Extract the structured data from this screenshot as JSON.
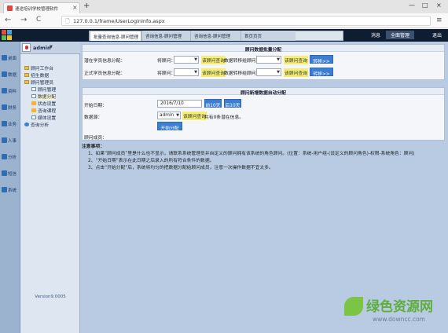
{
  "browser": {
    "tab_title": "速途培训学校管理软件",
    "tab_close": "×",
    "new_tab": "+",
    "window_controls": [
      "—",
      "□",
      "×"
    ],
    "nav": {
      "back": "←",
      "forward": "→",
      "reload": "C"
    },
    "url": "127.0.0.1/frame/UserLoginInfo.aspx",
    "menu": "≡"
  },
  "header": {
    "logo_colors": [
      "#e64b3b",
      "#4aa3df",
      "#5dbb46",
      "#f2c230"
    ],
    "tabs": [
      {
        "label": "批量查询信息-顾问管理",
        "active": true,
        "close": "×"
      },
      {
        "label": "咨询信息-顾问管理",
        "active": false
      },
      {
        "label": "咨询信息-顾问管理",
        "active": false
      },
      {
        "label": "首页页页",
        "active": false
      }
    ],
    "right": {
      "messages": "消息",
      "admin": "全面管理",
      "logout": "退出"
    }
  },
  "quickbar": [
    "桌面",
    "数据",
    "资料",
    "财务",
    "业务",
    "人事",
    "分析",
    "短信",
    "系统"
  ],
  "tree": {
    "username": "admin",
    "dropdown": "▼",
    "nodes": [
      {
        "label": "顾问工作台",
        "icon": "folder"
      },
      {
        "label": "招生数据",
        "icon": "folder"
      },
      {
        "label": "顾问管理员",
        "icon": "folder"
      },
      {
        "label": "顾问管理",
        "icon": "leaf"
      },
      {
        "label": "数据分配",
        "icon": "leaf"
      },
      {
        "label": "状态设置",
        "icon": "cart"
      },
      {
        "label": "咨询课程",
        "icon": "cart"
      },
      {
        "label": "媒体设置",
        "icon": "leaf"
      },
      {
        "label": "查询分析",
        "icon": "globe"
      }
    ],
    "version": "Version9.0005"
  },
  "section1": {
    "title": "顾问数据批量分配",
    "rows": [
      {
        "label": "潜在学员信息分配：",
        "consultant_label": "将顾问：",
        "arrow": "▼",
        "note": "该顾问查询",
        "transfer_label": "数据转移给顾问：",
        "note2": "该顾问查询",
        "button": "转移>>"
      },
      {
        "label": "正式学员信息分配：",
        "consultant_label": "将顾问：",
        "arrow": "▼",
        "note": "该顾问查询",
        "transfer_label": "数据转移给顾问：",
        "note2": "该顾问查询",
        "button": "转移>>"
      }
    ]
  },
  "section2": {
    "title": "顾问新增数据自动分配",
    "start_label": "开始日期：",
    "start_date": "2016/7/10",
    "btn_prev": "前10天",
    "btn_next": "后10天",
    "source_label": "数据源：",
    "source_value": "admin",
    "source_arrow": "▼",
    "source_note": "该顾问查询",
    "source_count": "共有0条潜在信息。",
    "start_button": "开始分配",
    "member_label": "顾问成员："
  },
  "notes": {
    "title": "注意事项：",
    "items": [
      "1、如果“顾问成员”里是什么也不显示，请联系系统管理员并自定义的顾问拥有该系统的角色顾问。(位置：系统-用户组-(设定义的顾问角色)-权限-系统角色：顾问)",
      "2、“开始日期”表示在此日期之后录入的所有符合条件的数据。",
      "3、点击“开始分配”后，系统将均匀的把数据分配给顾问成员，注意一次操作数据不宜太多。"
    ]
  },
  "watermark": {
    "title": "绿色资源网",
    "url": "www.downcc.com"
  }
}
